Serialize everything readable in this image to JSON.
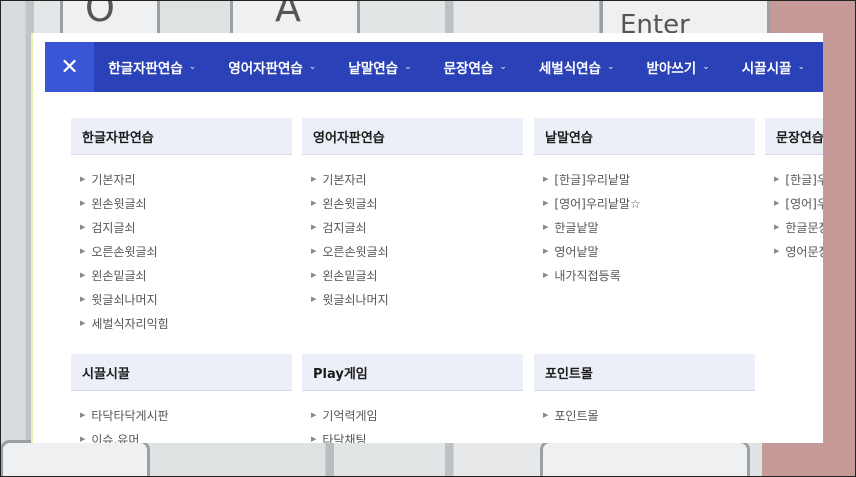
{
  "background": {
    "glyph_a": "A",
    "glyph_o": "O",
    "glyph_enter": "Enter"
  },
  "close_label": "✕",
  "nav": [
    {
      "label": "한글자판연습",
      "chevron": "⌄"
    },
    {
      "label": "영어자판연습",
      "chevron": "⌄"
    },
    {
      "label": "낱말연습",
      "chevron": "⌄"
    },
    {
      "label": "문장연습",
      "chevron": "⌄"
    },
    {
      "label": "세벌식연습",
      "chevron": "⌄"
    },
    {
      "label": "받아쓰기",
      "chevron": "⌄"
    },
    {
      "label": "시끌시끌",
      "chevron": "⌄"
    }
  ],
  "sections": [
    {
      "title": "한글자판연습",
      "items": [
        "기본자리",
        "왼손윗글쇠",
        "검지글쇠",
        "오른손윗글쇠",
        "왼손밑글쇠",
        "윗글쇠나머지",
        "세벌식자리익힘"
      ]
    },
    {
      "title": "영어자판연습",
      "items": [
        "기본자리",
        "왼손윗글쇠",
        "검지글쇠",
        "오른손윗글쇠",
        "왼손밑글쇠",
        "윗글쇠나머지"
      ]
    },
    {
      "title": "낱말연습",
      "items": [
        "[한글]우리낱말",
        "[영어]우리낱말☆",
        "한글낱말",
        "영어낱말",
        "내가직접등록"
      ]
    },
    {
      "title": "문장연습",
      "items": [
        "[한글]우",
        "[영어]우",
        "한글문장",
        "영어문장"
      ]
    },
    {
      "title": "시끌시끌",
      "items": [
        "타닥타닥게시판",
        "이슈.유머"
      ]
    },
    {
      "title": "Play게임",
      "items": [
        "기억력게임",
        "타닥채팅"
      ]
    },
    {
      "title": "포인트몰",
      "items": [
        "포인트몰"
      ]
    }
  ],
  "colors": {
    "topbar": "#2a41b8",
    "close_bg": "#3a56d6",
    "section_header": "#eceff7"
  }
}
